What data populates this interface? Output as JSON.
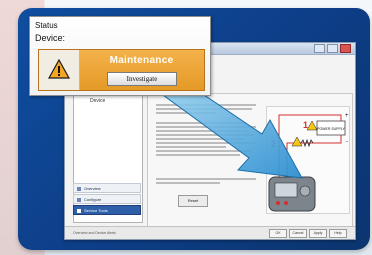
{
  "status_popup": {
    "title": "Status",
    "device_label": "Device:",
    "maintenance_label": "Maintenance",
    "investigate_label": "Investigate",
    "icon": "warning-icon"
  },
  "app": {
    "left_panel": {
      "item_label": "Device"
    },
    "nav": [
      {
        "label": "Overview"
      },
      {
        "label": "Configure"
      },
      {
        "label": "Service Tools"
      }
    ],
    "content": {
      "reset_label": "Reset"
    },
    "diagram": {
      "callouts": [
        "1",
        "2"
      ],
      "supply_label": "POWER SUPPLY",
      "plus": "+",
      "minus": "-"
    },
    "bottom_bar": {
      "status_text": "Overview and Device Alerts",
      "buttons": [
        "OK",
        "Cancel",
        "Apply",
        "Help"
      ]
    }
  },
  "colors": {
    "frame": "#0f4ea0",
    "maintenance": "#e59a27",
    "arrow": "#3aa0d8",
    "alert_red": "#d32f2f"
  }
}
